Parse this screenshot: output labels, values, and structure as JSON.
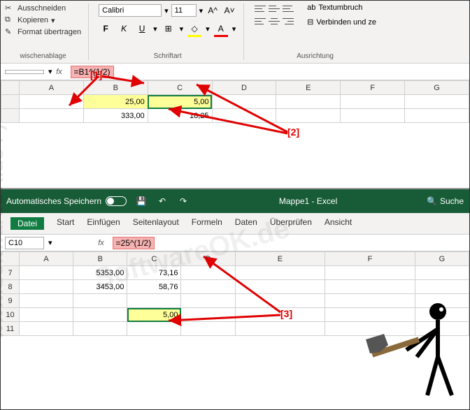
{
  "panel1": {
    "clipboard": {
      "cut": "Ausschneiden",
      "copy": "Kopieren",
      "paste_format": "Format übertragen",
      "group_label": "wischenablage"
    },
    "font": {
      "name": "Calibri",
      "size": "11",
      "group_label": "Schriftart"
    },
    "alignment": {
      "wrap": "Textumbruch",
      "merge": "Verbinden und ze",
      "group_label": "Ausrichtung"
    },
    "formula": "=B1^(1/2)",
    "columns": [
      "A",
      "B",
      "C",
      "D",
      "E",
      "F",
      "G"
    ],
    "rows": [
      {
        "B": "25,00",
        "C": "5,00"
      },
      {
        "B": "333,00",
        "C": "18,25"
      }
    ]
  },
  "panel2": {
    "autosave": "Automatisches Speichern",
    "title": "Mappe1  -  Excel",
    "search": "Suche",
    "tabs": [
      "Datei",
      "Start",
      "Einfügen",
      "Seitenlayout",
      "Formeln",
      "Daten",
      "Überprüfen",
      "Ansicht"
    ],
    "namebox": "C10",
    "formula": "=25^(1/2)",
    "columns": [
      "A",
      "B",
      "C",
      "D",
      "E",
      "F",
      "G"
    ],
    "rows": [
      {
        "n": "7",
        "B": "5353,00",
        "C": "73,16"
      },
      {
        "n": "8",
        "B": "3453,00",
        "C": "58,76"
      },
      {
        "n": "9"
      },
      {
        "n": "10",
        "C": "5,00"
      },
      {
        "n": "11"
      }
    ]
  },
  "annotations": {
    "a1": "[1]",
    "a2": "[2]",
    "a3": "[3]"
  },
  "watermark": "www.SoftwareOK.de :-)",
  "watermark2": "SoftwareOK.de"
}
